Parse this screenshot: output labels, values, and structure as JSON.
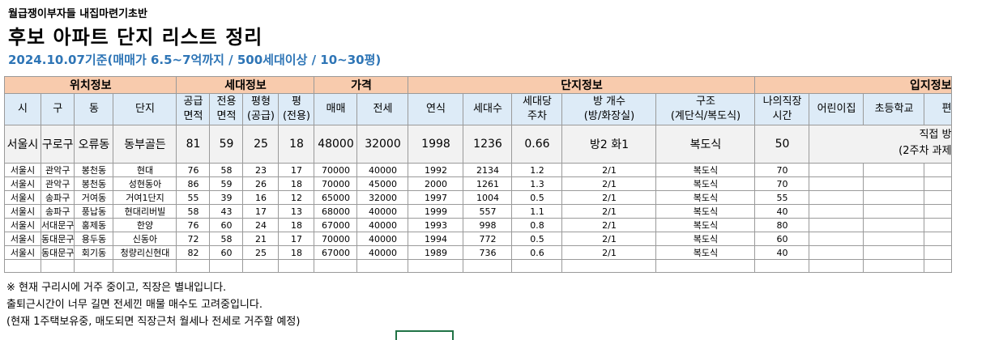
{
  "header": {
    "pretitle": "월급쟁이부자들 내집마련기초반",
    "title": "후보 아파트 단지 리스트 정리",
    "subtitle": "2024.10.07기준(매매가 6.5~7억까지 / 500세대이상 / 10~30평)"
  },
  "groups": {
    "location": "위치정보",
    "household": "세대정보",
    "price": "가격",
    "complex": "단지정보",
    "site": "입지정보"
  },
  "columns": {
    "si": "시",
    "gu": "구",
    "dong": "동",
    "danji": "단지",
    "supply_1": "공급",
    "supply_2": "면적",
    "exclusive_1": "전용",
    "exclusive_2": "면적",
    "pyeongtype_1": "평형",
    "pyeongtype_2": "(공급)",
    "pyeong_1": "평",
    "pyeong_2": "(전용)",
    "sale": "매매",
    "jeonse": "전세",
    "year": "연식",
    "households": "세대수",
    "parking_1": "세대당",
    "parking_2": "주차",
    "rooms_1": "방 개수",
    "rooms_2": "(방/화장실)",
    "structure_1": "구조",
    "structure_2": "(계단식/복도식)",
    "commute_1": "나의직장",
    "commute_2": "시간",
    "daycare": "어린이집",
    "school": "초등학교",
    "convenience": "편"
  },
  "example": {
    "si": "서울시",
    "gu": "구로구",
    "dong": "오류동",
    "danji": "동부골든",
    "supply": "81",
    "exclusive": "59",
    "pyeongtype": "25",
    "pyeong": "18",
    "sale": "48000",
    "jeonse": "32000",
    "year": "1998",
    "households": "1236",
    "parking": "0.66",
    "rooms": "방2 화1",
    "structure": "복도식",
    "commute": "50",
    "note_1": "직접 방",
    "note_2": "(2주차 과제"
  },
  "rows": [
    {
      "si": "서울시",
      "gu": "관악구",
      "dong": "봉천동",
      "danji": "현대",
      "supply": "76",
      "exclusive": "58",
      "pyeongtype": "23",
      "pyeong": "17",
      "sale": "70000",
      "jeonse": "40000",
      "year": "1992",
      "households": "2134",
      "parking": "1.2",
      "rooms": "2/1",
      "structure": "복도식",
      "commute": "70"
    },
    {
      "si": "서울시",
      "gu": "관악구",
      "dong": "봉천동",
      "danji": "성현동아",
      "supply": "86",
      "exclusive": "59",
      "pyeongtype": "26",
      "pyeong": "18",
      "sale": "70000",
      "jeonse": "45000",
      "year": "2000",
      "households": "1261",
      "parking": "1.3",
      "rooms": "2/1",
      "structure": "복도식",
      "commute": "70"
    },
    {
      "si": "서울시",
      "gu": "송파구",
      "dong": "거여동",
      "danji": "거여1단지",
      "supply": "55",
      "exclusive": "39",
      "pyeongtype": "16",
      "pyeong": "12",
      "sale": "65000",
      "jeonse": "32000",
      "year": "1997",
      "households": "1004",
      "parking": "0.5",
      "rooms": "2/1",
      "structure": "복도식",
      "commute": "55"
    },
    {
      "si": "서울시",
      "gu": "송파구",
      "dong": "풍납동",
      "danji": "현대리버빌",
      "supply": "58",
      "exclusive": "43",
      "pyeongtype": "17",
      "pyeong": "13",
      "sale": "68000",
      "jeonse": "40000",
      "year": "1999",
      "households": "557",
      "parking": "1.1",
      "rooms": "2/1",
      "structure": "복도식",
      "commute": "40"
    },
    {
      "si": "서울시",
      "gu": "서대문구",
      "dong": "홍제동",
      "danji": "한양",
      "supply": "76",
      "exclusive": "60",
      "pyeongtype": "24",
      "pyeong": "18",
      "sale": "67000",
      "jeonse": "40000",
      "year": "1993",
      "households": "998",
      "parking": "0.8",
      "rooms": "2/1",
      "structure": "복도식",
      "commute": "80"
    },
    {
      "si": "서울시",
      "gu": "동대문구",
      "dong": "용두동",
      "danji": "신동아",
      "supply": "72",
      "exclusive": "58",
      "pyeongtype": "21",
      "pyeong": "17",
      "sale": "70000",
      "jeonse": "40000",
      "year": "1994",
      "households": "772",
      "parking": "0.5",
      "rooms": "2/1",
      "structure": "복도식",
      "commute": "60"
    },
    {
      "si": "서울시",
      "gu": "동대문구",
      "dong": "회기동",
      "danji": "청량리신현대",
      "supply": "82",
      "exclusive": "60",
      "pyeongtype": "25",
      "pyeong": "18",
      "sale": "67000",
      "jeonse": "40000",
      "year": "1989",
      "households": "736",
      "parking": "0.6",
      "rooms": "2/1",
      "structure": "복도식",
      "commute": "40"
    }
  ],
  "notes": [
    "※ 현재 구리시에 거주 중이고, 직장은 별내입니다.",
    "출퇴근시간이 너무 길면 전세낀 매물 매수도 고려중입니다.",
    "(현재 1주택보유중, 매도되면 직장근처 월세나 전세로 거주할 예정)"
  ],
  "colors": {
    "group_header": "#F8CBAD",
    "column_header": "#DDEBF7",
    "example_row": "#F2F2F2",
    "subtitle": "#2E75B6"
  }
}
